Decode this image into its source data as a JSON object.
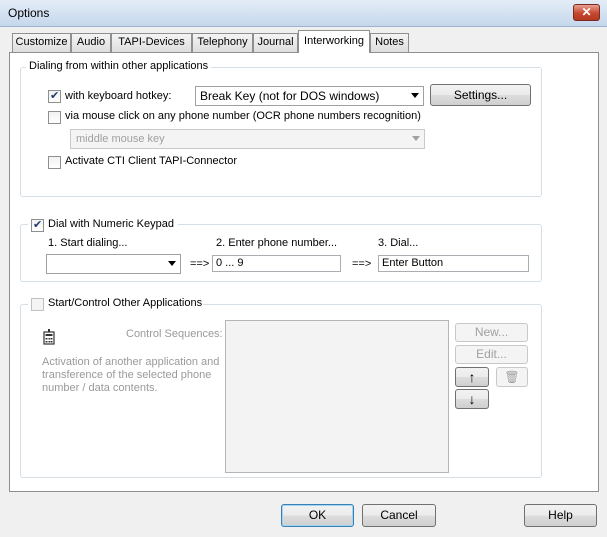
{
  "window": {
    "title": "Options",
    "close_glyph": "✕"
  },
  "tabs": [
    "Customize",
    "Audio",
    "TAPI-Devices",
    "Telephony",
    "Journal",
    "Interworking",
    "Notes"
  ],
  "dialing": {
    "group_label": "Dialing from within other applications",
    "hotkey_label": "with keyboard hotkey:",
    "hotkey_value": "Break Key (not for DOS windows)",
    "settings_button": "Settings...",
    "mouse_label": "via mouse click on any phone number (OCR phone numbers recognition)",
    "mouse_value": "middle mouse key",
    "cti_label": "Activate CTI Client TAPI-Connector"
  },
  "numeric": {
    "group_label": "Dial with Numeric Keypad",
    "step1": "1. Start dialing...",
    "step2": "2. Enter phone number...",
    "step3": "3. Dial...",
    "start_value": "",
    "arrow": "==>",
    "number_value": "0 ... 9",
    "dial_value": "Enter Button"
  },
  "other": {
    "group_label": "Start/Control Other Applications",
    "sequences_label": "Control Sequences:",
    "description": "Activation of another application and transference of the selected phone number / data contents.",
    "new_button": "New...",
    "edit_button": "Edit...",
    "up_glyph": "↑",
    "down_glyph": "↓",
    "trash_glyph": "🗑"
  },
  "footer": {
    "ok": "OK",
    "cancel": "Cancel",
    "help": "Help"
  }
}
